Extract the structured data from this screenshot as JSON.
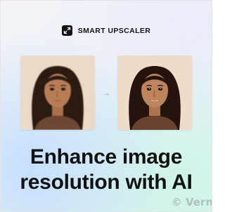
{
  "brand": {
    "name": "SMART UPSCALER",
    "icon": "expand-arrows-icon"
  },
  "comparison": {
    "arrow": "→",
    "arrow_icon": "arrow-right-icon",
    "before_image": "portrait-low-resolution",
    "after_image": "portrait-high-resolution"
  },
  "headline": {
    "line1": "Enhance image",
    "line2": "resolution with AI"
  },
  "watermark": "© Vern",
  "colors": {
    "text": "#111111",
    "brand_icon": "#121212",
    "arrow": "#9a9aa3"
  }
}
